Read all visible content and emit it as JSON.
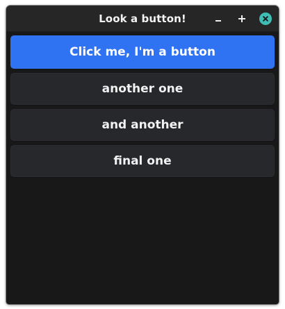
{
  "window": {
    "title": "Look a button!",
    "controls": {
      "minimize_icon": "minimize-icon",
      "maximize_icon": "plus-icon",
      "close_icon": "close-icon",
      "close_color": "#3fbdb4"
    }
  },
  "buttons": [
    {
      "label": "Click me, I'm a button",
      "style": "primary",
      "color": "#2f73f2"
    },
    {
      "label": "another one",
      "style": "secondary",
      "color": "#27282c"
    },
    {
      "label": "and another",
      "style": "secondary",
      "color": "#27282c"
    },
    {
      "label": "final one",
      "style": "secondary",
      "color": "#27282c"
    }
  ]
}
